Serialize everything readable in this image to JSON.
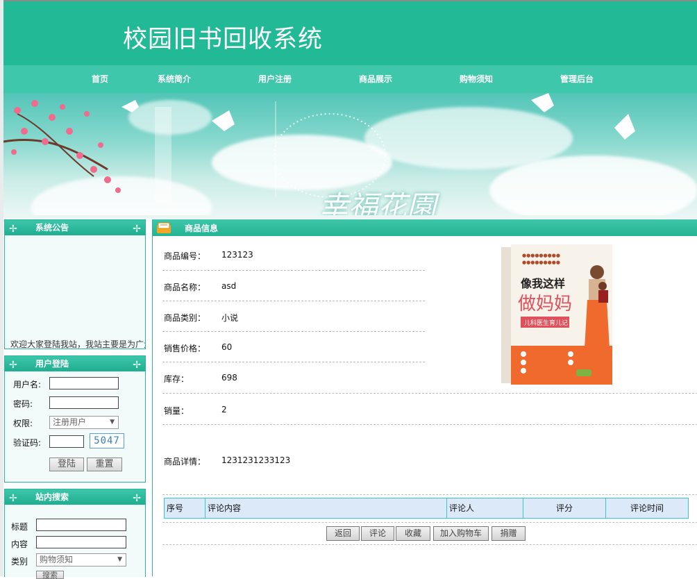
{
  "site": {
    "title": "校园旧书回收系统"
  },
  "nav": [
    "首页",
    "系统简介",
    "用户注册",
    "商品展示",
    "购物须知",
    "管理后台"
  ],
  "banner": {
    "text": "幸福花園"
  },
  "notice_box": {
    "title": "系统公告",
    "text": "欢迎大家登陆我站，我站主要是为广大"
  },
  "login_box": {
    "title": "用户登陆",
    "username_label": "用户名:",
    "password_label": "密码:",
    "role_label": "权限:",
    "role_value": "注册用户",
    "captcha_label": "验证码:",
    "captcha_code": "5047",
    "login_button": "登陆",
    "reset_button": "重置"
  },
  "search_box": {
    "title": "站内搜索",
    "title_label": "标题",
    "content_label": "内容",
    "category_label": "类别",
    "category_value": "购物须知",
    "search_button": "搜索"
  },
  "product": {
    "section_title": "商品信息",
    "fields": [
      {
        "label": "商品编号：",
        "value": "123123"
      },
      {
        "label": "商品名称：",
        "value": "asd"
      },
      {
        "label": "商品类别：",
        "value": "小说"
      },
      {
        "label": "销售价格：",
        "value": "60"
      },
      {
        "label": "库存：",
        "value": "698"
      },
      {
        "label": "销量：",
        "value": "2"
      },
      {
        "label": "商品详情：",
        "value": "1231231233123"
      }
    ],
    "cover": {
      "title_line1": "像我这样",
      "title_line2": "做妈妈",
      "subtitle": "儿科医生育儿记"
    }
  },
  "comments": {
    "headers": [
      "序号",
      "评论内容",
      "评论人",
      "评分",
      "评论时间"
    ]
  },
  "actions": [
    "返回",
    "评论",
    "收藏",
    "加入购物车",
    "捐赠"
  ]
}
